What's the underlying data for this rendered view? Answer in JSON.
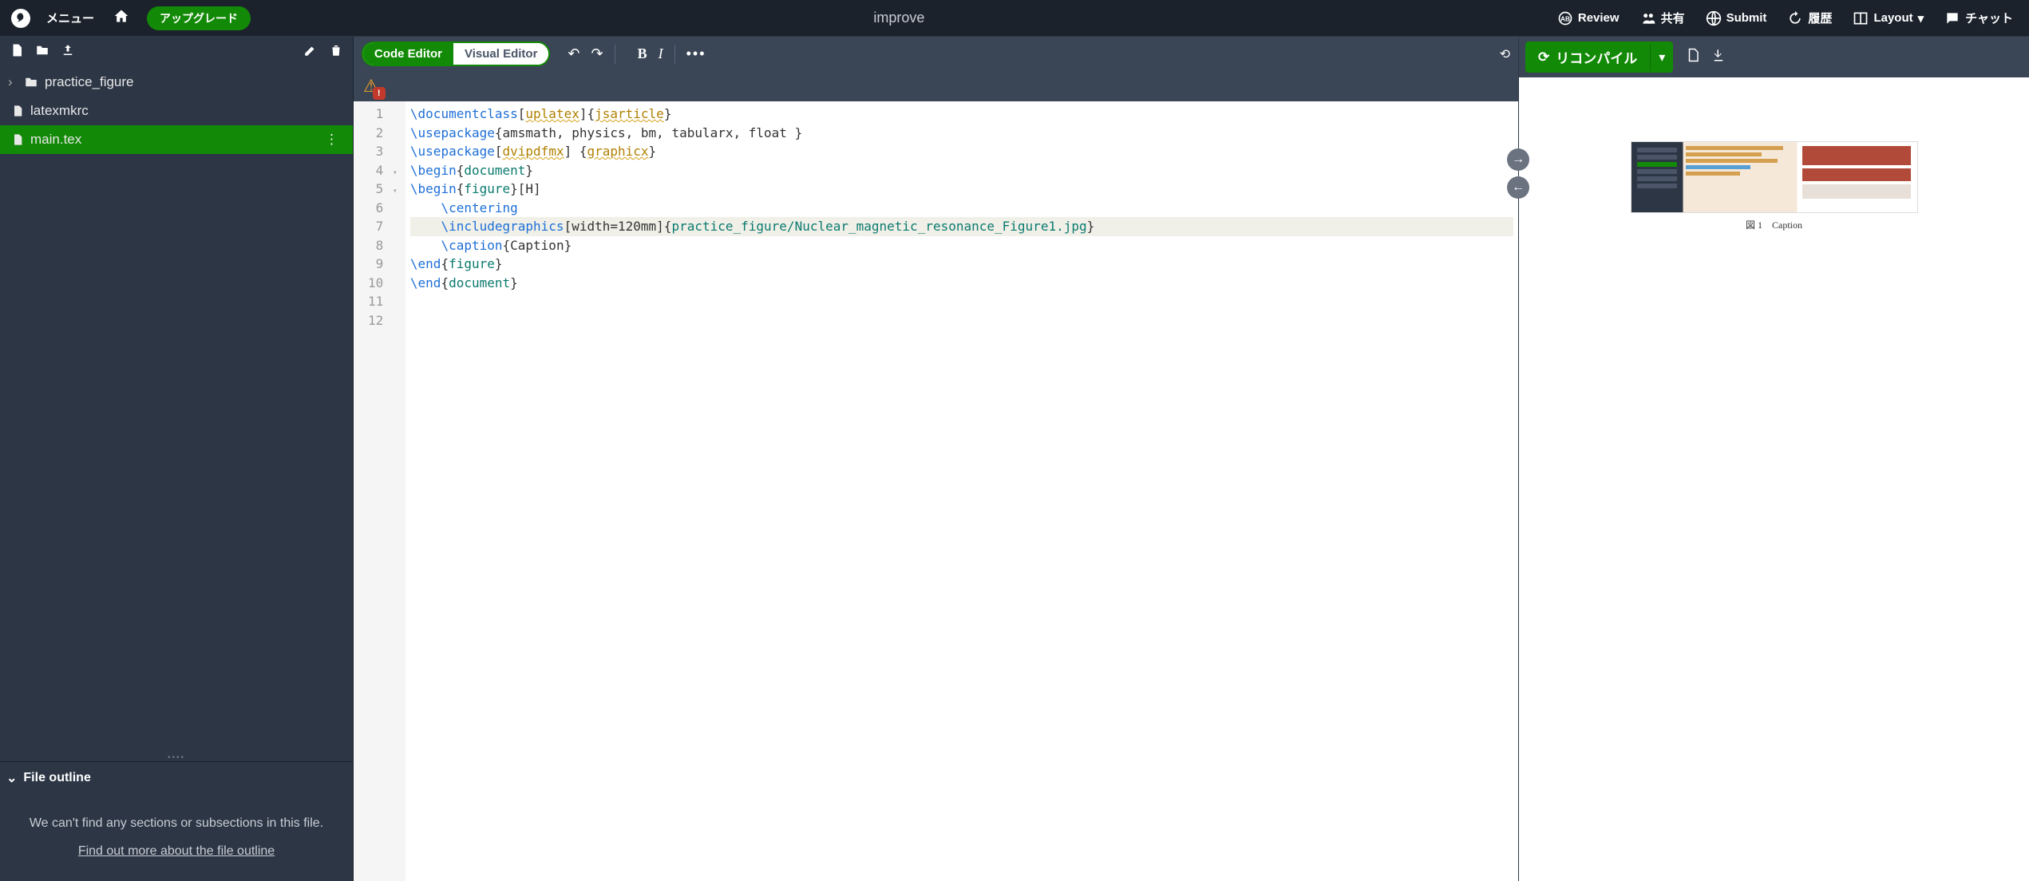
{
  "topbar": {
    "menu_label": "メニュー",
    "upgrade_label": "アップグレード",
    "project_title": "improve",
    "review_label": "Review",
    "share_label": "共有",
    "submit_label": "Submit",
    "history_label": "履歴",
    "layout_label": "Layout",
    "chat_label": "チャット"
  },
  "sidebar": {
    "items": [
      {
        "name": "practice_figure",
        "type": "folder"
      },
      {
        "name": "latexmkrc",
        "type": "file"
      },
      {
        "name": "main.tex",
        "type": "file",
        "selected": true
      }
    ],
    "outline_title": "File outline",
    "outline_empty_msg": "We can't find any sections or subsections in this file.",
    "outline_link": "Find out more about the file outline"
  },
  "editor": {
    "mode_code": "Code Editor",
    "mode_visual": "Visual Editor",
    "lines": [
      {
        "n": 1,
        "seg": [
          {
            "t": "\\documentclass",
            "c": "cmd"
          },
          {
            "t": "[",
            "c": "brace"
          },
          {
            "t": "uplatex",
            "c": "opt"
          },
          {
            "t": "]{",
            "c": "brace"
          },
          {
            "t": "jsarticle",
            "c": "opt"
          },
          {
            "t": "}",
            "c": "brace"
          }
        ]
      },
      {
        "n": 2,
        "seg": [
          {
            "t": "\\usepackage",
            "c": "cmd"
          },
          {
            "t": "{",
            "c": "brace"
          },
          {
            "t": "amsmath, physics, bm, tabularx, float ",
            "c": "text"
          },
          {
            "t": "}",
            "c": "brace"
          }
        ]
      },
      {
        "n": 3,
        "seg": [
          {
            "t": "\\usepackage",
            "c": "cmd"
          },
          {
            "t": "[",
            "c": "brace"
          },
          {
            "t": "dvipdfmx",
            "c": "opt"
          },
          {
            "t": "] {",
            "c": "brace"
          },
          {
            "t": "graphicx",
            "c": "opt"
          },
          {
            "t": "}",
            "c": "brace"
          }
        ]
      },
      {
        "n": 4,
        "fold": true,
        "seg": [
          {
            "t": "\\begin",
            "c": "cmd"
          },
          {
            "t": "{",
            "c": "brace"
          },
          {
            "t": "document",
            "c": "arg"
          },
          {
            "t": "}",
            "c": "brace"
          }
        ]
      },
      {
        "n": 5,
        "fold": true,
        "seg": [
          {
            "t": "\\begin",
            "c": "cmd"
          },
          {
            "t": "{",
            "c": "brace"
          },
          {
            "t": "figure",
            "c": "arg"
          },
          {
            "t": "}",
            "c": "brace"
          },
          {
            "t": "[H]",
            "c": "text"
          }
        ]
      },
      {
        "n": 6,
        "indent": 1,
        "seg": [
          {
            "t": "\\centering",
            "c": "cmd"
          }
        ]
      },
      {
        "n": 7,
        "indent": 1,
        "hl": true,
        "seg": [
          {
            "t": "\\includegraphics",
            "c": "cmd"
          },
          {
            "t": "[width=120mm]",
            "c": "text"
          },
          {
            "t": "{",
            "c": "brace"
          },
          {
            "t": "practice_figure/Nuclear_magnetic_resonance_Figure1.jpg",
            "c": "arg"
          },
          {
            "t": "}",
            "c": "brace"
          }
        ]
      },
      {
        "n": 8,
        "indent": 1,
        "seg": [
          {
            "t": "\\caption",
            "c": "cmd"
          },
          {
            "t": "{",
            "c": "brace"
          },
          {
            "t": "Caption",
            "c": "text"
          },
          {
            "t": "}",
            "c": "brace"
          }
        ]
      },
      {
        "n": 9,
        "seg": [
          {
            "t": "\\end",
            "c": "cmd"
          },
          {
            "t": "{",
            "c": "brace"
          },
          {
            "t": "figure",
            "c": "arg"
          },
          {
            "t": "}",
            "c": "brace"
          }
        ]
      },
      {
        "n": 10,
        "seg": [
          {
            "t": "\\end",
            "c": "cmd"
          },
          {
            "t": "{",
            "c": "brace"
          },
          {
            "t": "document",
            "c": "arg"
          },
          {
            "t": "}",
            "c": "brace"
          }
        ]
      },
      {
        "n": 11,
        "seg": []
      },
      {
        "n": 12,
        "seg": []
      }
    ]
  },
  "preview": {
    "recompile_label": "リコンパイル",
    "caption": "図 1　Caption"
  }
}
